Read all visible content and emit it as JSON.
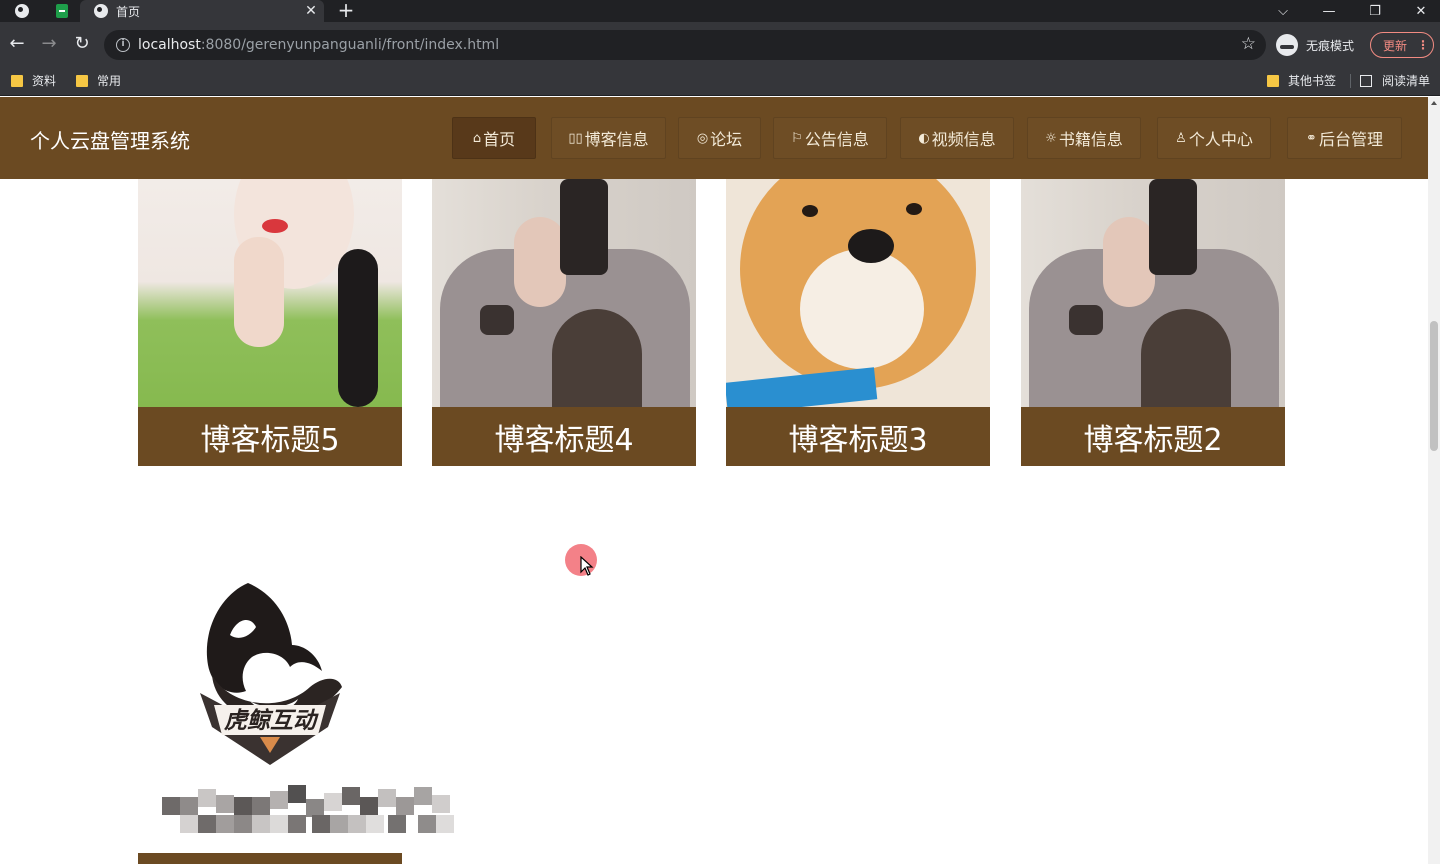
{
  "browser": {
    "tab_title": "首页",
    "tab_close": "✕",
    "new_tab": "+",
    "controls": {
      "dropdown": "⌵",
      "minimize": "—",
      "restore": "❐",
      "close": "✕"
    },
    "nav": {
      "back": "←",
      "forward": "→",
      "reload": "↻"
    },
    "url_host": "localhost",
    "url_rest": ":8080/gerenyunpanguanli/front/index.html",
    "incognito_label": "无痕模式",
    "update_label": "更新",
    "update_menu": "⋮",
    "bookmarks": [
      {
        "label": "资料"
      },
      {
        "label": "常用"
      }
    ],
    "bookmarks_right": [
      {
        "label": "其他书签"
      },
      {
        "label": "阅读清单"
      }
    ]
  },
  "site": {
    "title": "个人云盘管理系统",
    "nav": [
      {
        "icon": "⌂",
        "icon_name": "home-icon",
        "label": "首页",
        "active": true
      },
      {
        "icon": "▯▯",
        "icon_name": "blog-icon",
        "label": "博客信息",
        "active": false
      },
      {
        "icon": "◎",
        "icon_name": "forum-icon",
        "label": "论坛",
        "active": false
      },
      {
        "icon": "⚐",
        "icon_name": "flag-icon",
        "label": "公告信息",
        "active": false
      },
      {
        "icon": "◐",
        "icon_name": "video-icon",
        "label": "视频信息",
        "active": false
      },
      {
        "icon": "☼",
        "icon_name": "book-icon",
        "label": "书籍信息",
        "active": false
      },
      {
        "icon": "♙",
        "icon_name": "user-icon",
        "label": "个人中心",
        "active": false
      },
      {
        "icon": "⚭",
        "icon_name": "link-icon",
        "label": "后台管理",
        "active": false
      }
    ]
  },
  "blogs": [
    {
      "title": "博客标题5"
    },
    {
      "title": "博客标题4"
    },
    {
      "title": "博客标题3"
    },
    {
      "title": "博客标题2"
    }
  ],
  "logo_text": "虎鲸互动",
  "colors": {
    "header_brown": "#6b4a22",
    "active_nav": "#58391a",
    "caption_brown": "#6b4a22"
  }
}
